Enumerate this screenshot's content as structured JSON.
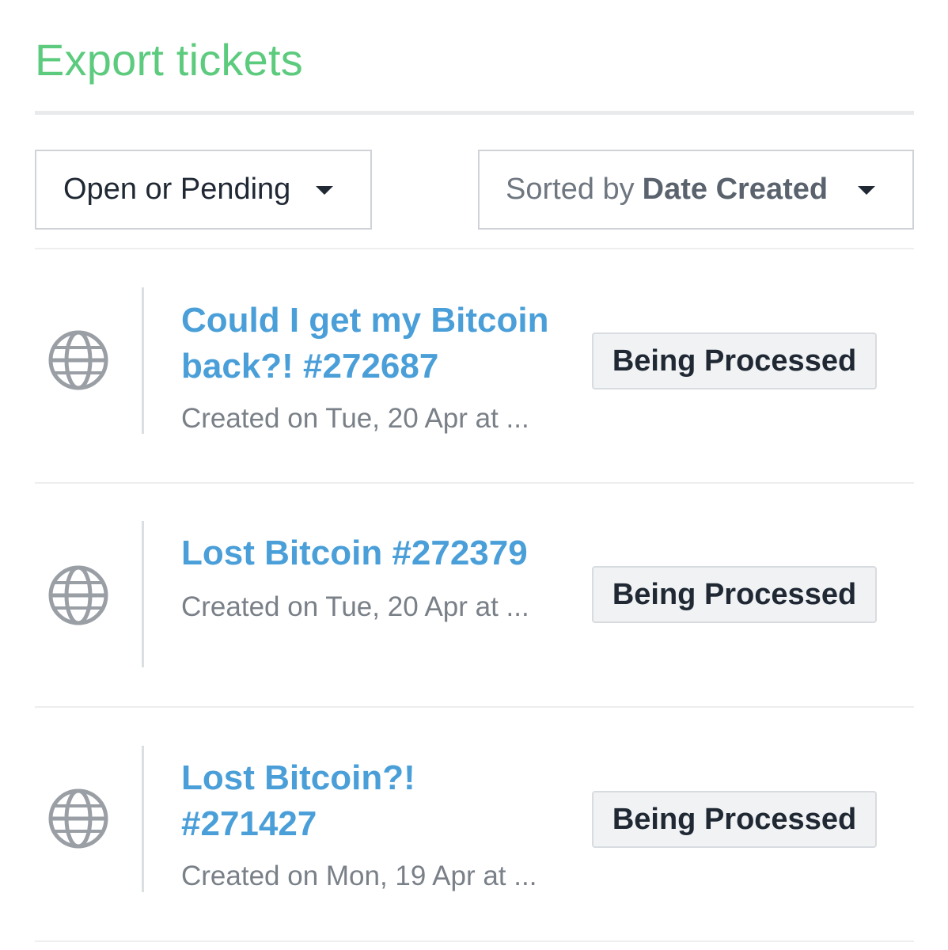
{
  "header": {
    "title": "Export tickets"
  },
  "filters": {
    "status_value": "Open or Pending",
    "sort_prefix": "Sorted by",
    "sort_value": "Date Created"
  },
  "icons": {
    "ticket_source": "globe-icon",
    "dropdown": "caret-down-icon"
  },
  "colors": {
    "title": "#5ccb7e",
    "ticket_link": "#4a9fd9",
    "meta_text": "#7a8088",
    "badge_bg": "#f0f2f4"
  },
  "tickets": [
    {
      "title": "Could I get my Bitcoin back?! #272687",
      "meta": "Created on Tue, 20 Apr at ...",
      "status": "Being Processed"
    },
    {
      "title": "Lost Bitcoin #272379",
      "meta": "Created on Tue, 20 Apr at ...",
      "status": "Being Processed"
    },
    {
      "title": "Lost Bitcoin?! #271427",
      "meta": "Created on Mon, 19 Apr at ...",
      "status": "Being Processed"
    }
  ]
}
